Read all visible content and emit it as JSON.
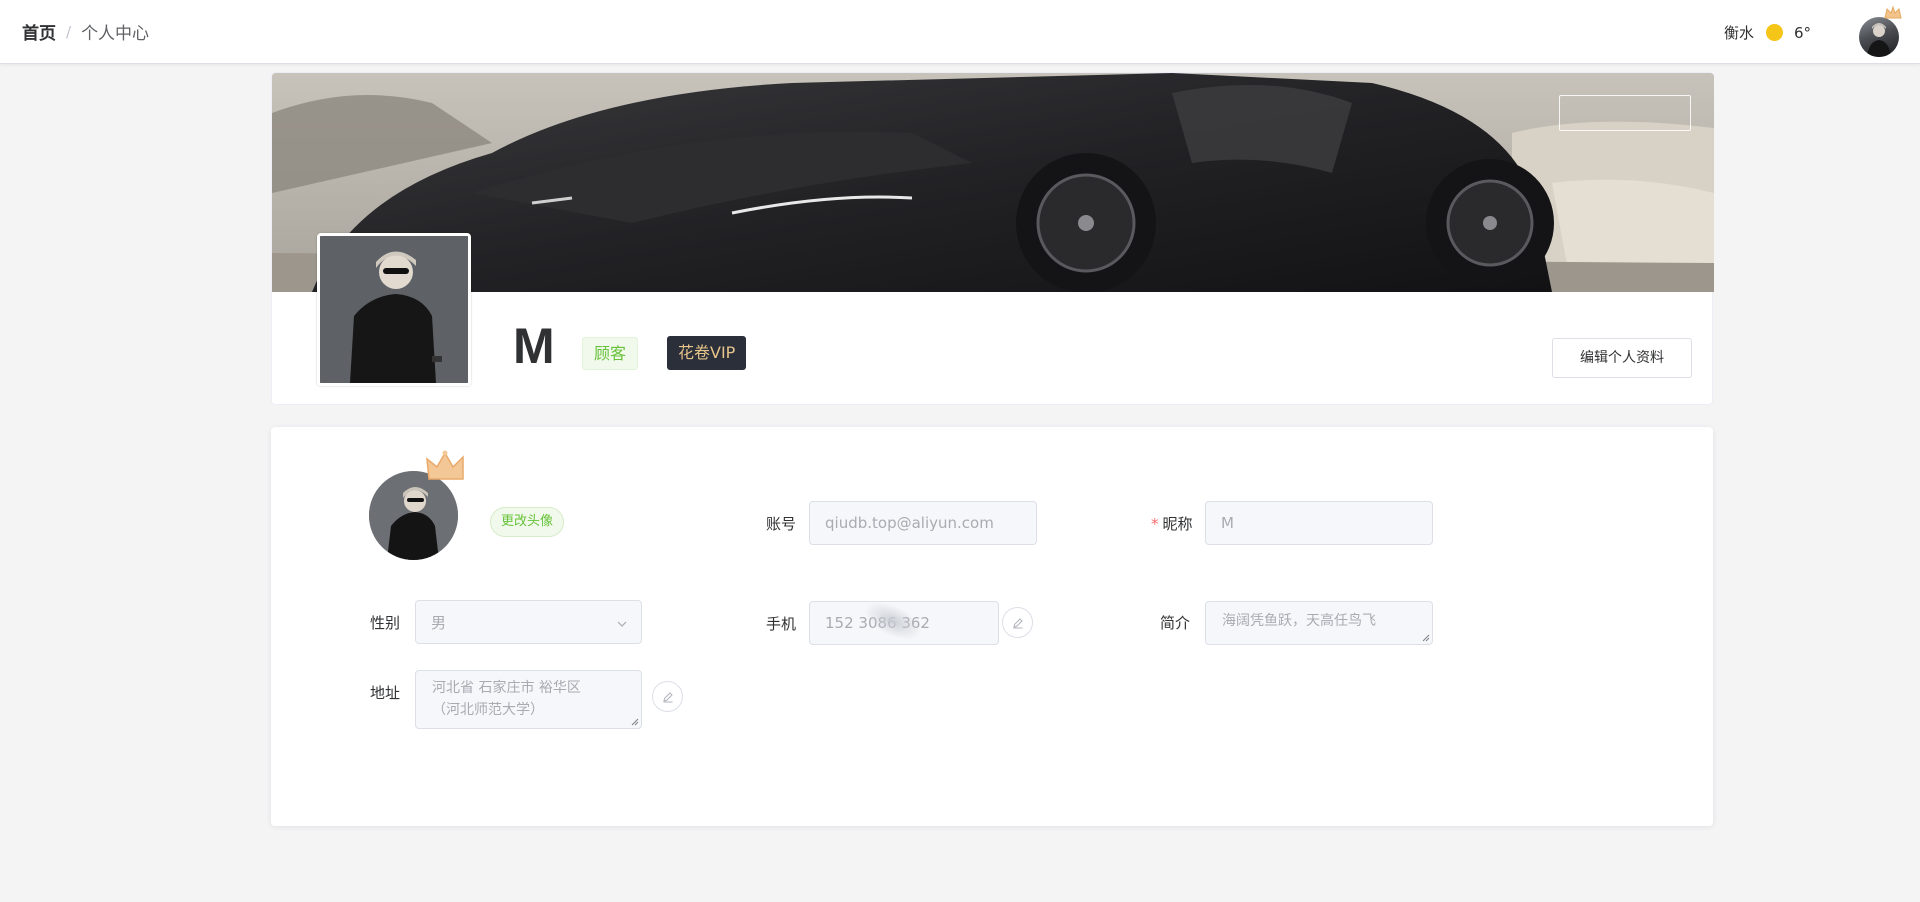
{
  "header": {
    "breadcrumb": {
      "home": "首页",
      "separator": "/",
      "current": "个人中心"
    },
    "weather": {
      "city": "衡水",
      "temperature": "6°",
      "icon": "sun-icon",
      "sun_color": "#f5c518"
    }
  },
  "profile": {
    "name": "M",
    "role_tag": "顾客",
    "vip_tag": "花卷VIP",
    "edit_button": "编辑个人资料"
  },
  "form": {
    "change_avatar": "更改头像",
    "account": {
      "label": "账号",
      "value": "qiudb.top@aliyun.com"
    },
    "nickname": {
      "label": "昵称",
      "required_mark": "*",
      "value": "M"
    },
    "gender": {
      "label": "性别",
      "value": "男"
    },
    "phone": {
      "label": "手机",
      "value": "152 3086 362"
    },
    "bio": {
      "label": "简介",
      "value": "海阔凭鱼跃，天高任鸟飞"
    },
    "address": {
      "label": "地址",
      "line1": "河北省  石家庄市  裕华区",
      "line2": "（河北师范大学）"
    }
  },
  "colors": {
    "accent_green": "#67c23a",
    "vip_bg": "#2b2f3a",
    "vip_text": "#e6c48a",
    "required": "#f56c6c"
  }
}
